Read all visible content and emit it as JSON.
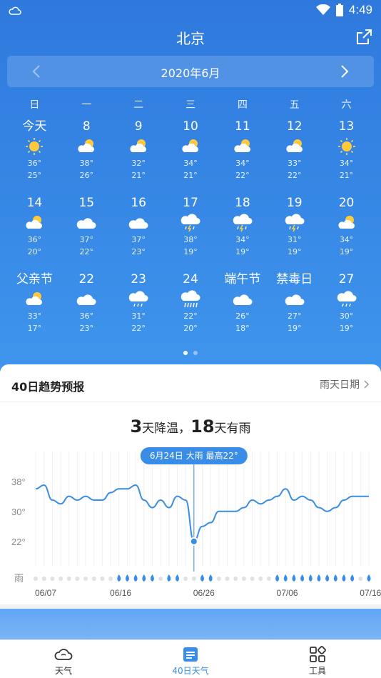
{
  "status_bar": {
    "time": "4:49"
  },
  "header": {
    "city": "北京"
  },
  "calendar": {
    "month_label": "2020年6月",
    "weekdays": [
      "日",
      "一",
      "二",
      "三",
      "四",
      "五",
      "六"
    ],
    "days": [
      {
        "label": "今天",
        "icon": "sun-icon",
        "hi": "36°",
        "lo": "25°"
      },
      {
        "label": "8",
        "icon": "partly-cloudy-icon",
        "hi": "38°",
        "lo": "26°"
      },
      {
        "label": "9",
        "icon": "partly-cloudy-icon",
        "hi": "32°",
        "lo": "21°"
      },
      {
        "label": "10",
        "icon": "partly-cloudy-icon",
        "hi": "34°",
        "lo": "21°"
      },
      {
        "label": "11",
        "icon": "partly-cloudy-icon",
        "hi": "34°",
        "lo": "22°"
      },
      {
        "label": "12",
        "icon": "partly-cloudy-icon",
        "hi": "33°",
        "lo": "22°"
      },
      {
        "label": "13",
        "icon": "sun-icon",
        "hi": "34°",
        "lo": "21°"
      },
      {
        "label": "14",
        "icon": "partly-cloudy-icon",
        "hi": "36°",
        "lo": "20°"
      },
      {
        "label": "15",
        "icon": "cloud-icon",
        "hi": "37°",
        "lo": "22°"
      },
      {
        "label": "16",
        "icon": "cloud-icon",
        "hi": "37°",
        "lo": "23°"
      },
      {
        "label": "17",
        "icon": "thunder-rain-icon",
        "hi": "38°",
        "lo": "19°"
      },
      {
        "label": "18",
        "icon": "thunder-rain-icon",
        "hi": "34°",
        "lo": "19°"
      },
      {
        "label": "19",
        "icon": "thunder-rain-icon",
        "hi": "31°",
        "lo": "19°"
      },
      {
        "label": "20",
        "icon": "partly-cloudy-icon",
        "hi": "34°",
        "lo": "19°"
      },
      {
        "label": "父亲节",
        "icon": "partly-cloudy-icon",
        "hi": "33°",
        "lo": "17°"
      },
      {
        "label": "22",
        "icon": "cloud-icon",
        "hi": "36°",
        "lo": "23°"
      },
      {
        "label": "23",
        "icon": "rain-icon",
        "hi": "31°",
        "lo": "22°"
      },
      {
        "label": "24",
        "icon": "heavy-rain-icon",
        "hi": "22°",
        "lo": "20°"
      },
      {
        "label": "端午节",
        "icon": "cloud-icon",
        "hi": "26°",
        "lo": "18°"
      },
      {
        "label": "禁毒日",
        "icon": "cloud-icon",
        "hi": "27°",
        "lo": "19°"
      },
      {
        "label": "27",
        "icon": "rain-icon",
        "hi": "30°",
        "lo": "19°"
      }
    ]
  },
  "trend": {
    "title": "40日趋势预报",
    "link": "雨天日期",
    "summary_num1": "3",
    "summary_text1": "天降温，",
    "summary_num2": "18",
    "summary_text2": "天有雨",
    "tooltip": "6月24日 大雨 最高22°",
    "rain_label": "雨"
  },
  "chart_data": {
    "type": "line",
    "y_ticks": [
      "38°",
      "30°",
      "22°"
    ],
    "ylim": [
      17,
      45
    ],
    "x_ticks": [
      "06/07",
      "06/16",
      "06/26",
      "07/06",
      "07/16"
    ],
    "x_tick_indices": [
      0,
      9,
      19,
      29,
      39
    ],
    "series": [
      {
        "values": [
          36,
          37,
          33,
          32,
          34,
          33,
          34,
          33,
          33,
          35,
          36,
          36,
          37,
          33,
          31,
          33,
          31,
          34,
          33,
          22,
          26,
          27,
          30,
          30,
          30,
          31,
          33,
          32,
          33,
          34,
          36,
          33,
          34,
          33,
          31,
          30,
          31,
          33,
          34,
          34,
          34
        ]
      }
    ],
    "rain_days": [
      10,
      11,
      12,
      13,
      14,
      16,
      17,
      20,
      21,
      29,
      30,
      31,
      32,
      33,
      34,
      35,
      36,
      37,
      38,
      40
    ],
    "highlight_index": 19
  },
  "tabs": [
    {
      "label": "天气",
      "icon": "cloud-outline-icon",
      "active": false
    },
    {
      "label": "40日天气",
      "icon": "calendar-list-icon",
      "active": true
    },
    {
      "label": "工具",
      "icon": "grid-tools-icon",
      "active": false
    }
  ]
}
